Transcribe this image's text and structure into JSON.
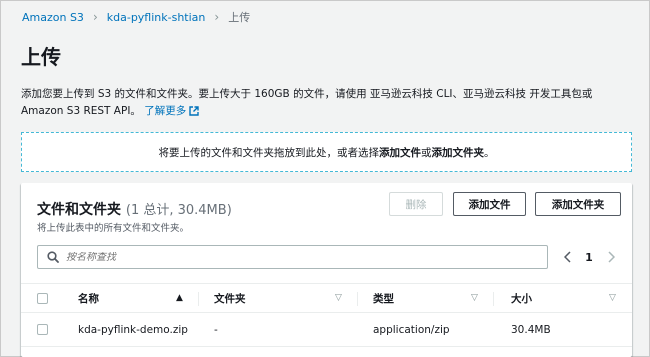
{
  "breadcrumb": {
    "items": [
      "Amazon S3",
      "kda-pyflink-shtian"
    ],
    "current": "上传"
  },
  "page": {
    "title": "上传",
    "description": "添加您要上传到 S3 的文件和文件夹。要上传大于 160GB 的文件，请使用 亚马逊云科技 CLI、亚马逊云科技 开发工具包或 Amazon S3 REST API。",
    "learn_more": "了解更多"
  },
  "dropzone": {
    "prefix": "将要上传的文件和文件夹拖放到此处，或者选择",
    "add_files": "添加文件",
    "or": "或",
    "add_folder": "添加文件夹",
    "suffix": "。"
  },
  "files_panel": {
    "title": "文件和文件夹",
    "count": "(1 总计, 30.4MB)",
    "subtitle": "将上传此表中的所有文件和文件夹。",
    "buttons": {
      "delete": "删除",
      "add_files": "添加文件",
      "add_folder": "添加文件夹"
    },
    "search_placeholder": "按名称查找",
    "pagination": {
      "current_page": "1"
    },
    "columns": {
      "name": "名称",
      "folder": "文件夹",
      "type": "类型",
      "size": "大小"
    },
    "rows": [
      {
        "name": "kda-pyflink-demo.zip",
        "folder": "-",
        "type": "application/zip",
        "size": "30.4MB"
      }
    ]
  },
  "colors": {
    "link": "#0073bb",
    "dropzone_border": "#44b9d6",
    "page_bg": "#f2f3f3"
  },
  "icons": [
    "chevron-right-icon",
    "external-link-icon",
    "search-icon",
    "chevron-left-icon",
    "sort-up-icon",
    "sort-down-icon",
    "checkbox-icon"
  ]
}
